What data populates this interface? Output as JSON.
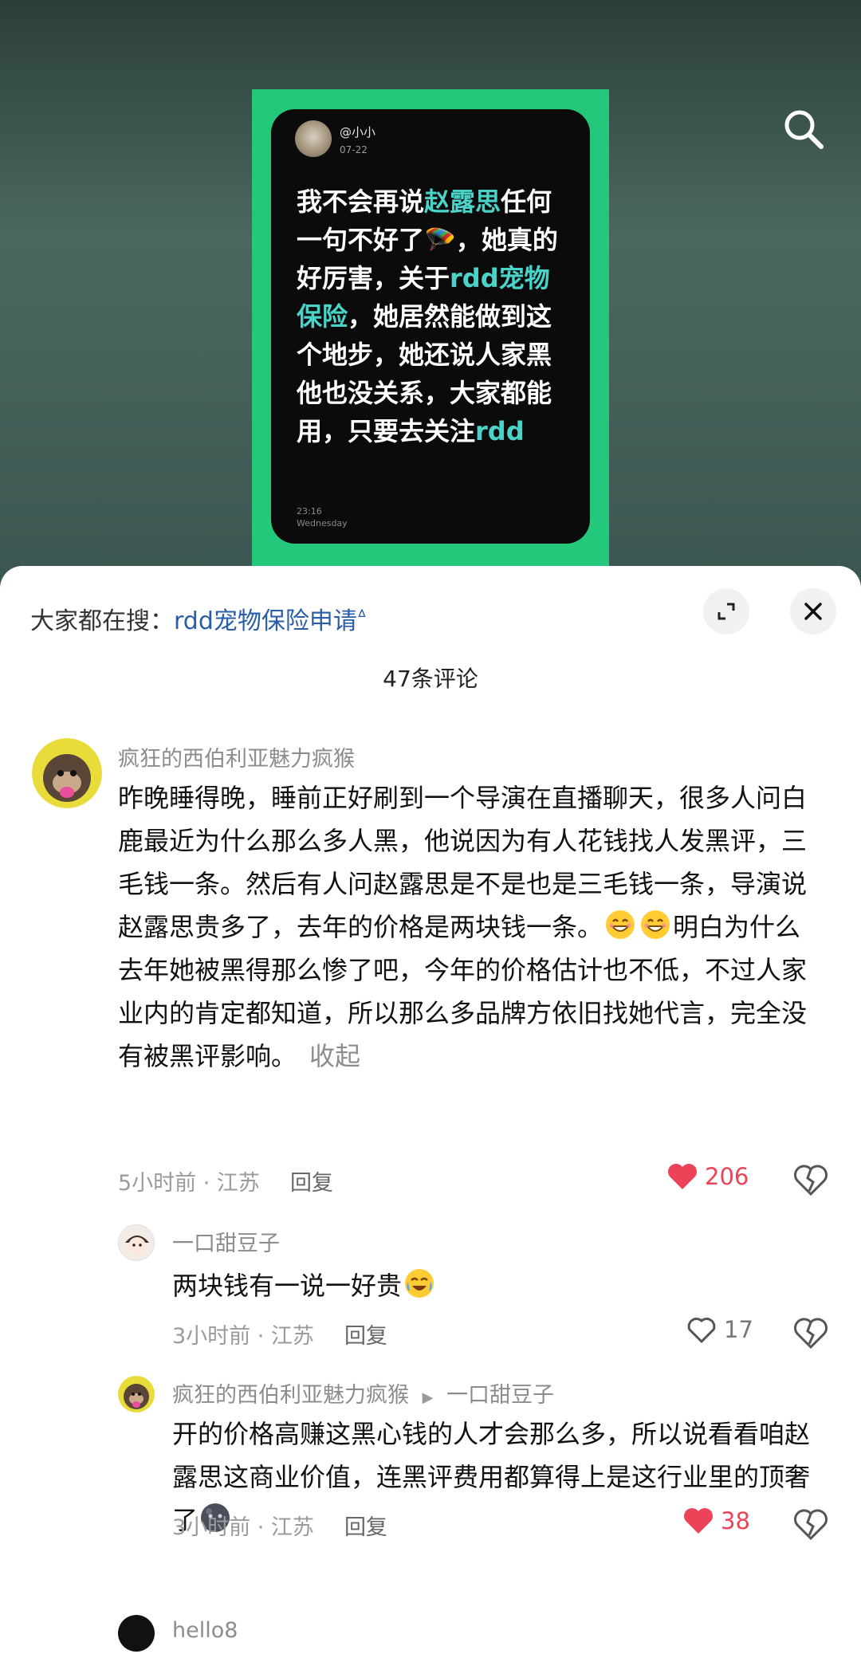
{
  "post": {
    "handle": "@小小",
    "date": "07-22",
    "segments": [
      {
        "text": "我不会再说",
        "hl": false
      },
      {
        "text": "赵露思",
        "hl": true
      },
      {
        "text": "任何一句不好了🪂，她真的好厉害，关于",
        "hl": false
      },
      {
        "text": "rdd宠物保险",
        "hl": true
      },
      {
        "text": "，她居然能做到这个地步，她还说人家黑他也没关系，大家都能用，只要去关注",
        "hl": false
      },
      {
        "text": "rdd",
        "hl": true
      }
    ],
    "time": "23:16",
    "weekday": "Wednesday"
  },
  "sheet": {
    "search_prefix": "大家都在搜：",
    "search_query": "rdd宠物保险申请",
    "comment_count": "47条评论"
  },
  "comments": [
    {
      "user": "疯狂的西伯利亚魅力疯猴",
      "text_a": "昨晚睡得晚，睡前正好刷到一个导演在直播聊天，很多人问白鹿最近为什么那么多人黑，他说因为有人花钱找人发黑评，三毛钱一条。然后有人问赵露思是不是也是三毛钱一条，导演说赵露思贵多了，去年的价格是两块钱一条。",
      "text_b": "明白为什么去年她被黑得那么惨了吧，今年的价格估计也不低，不过人家业内的肯定都知道，所以那么多品牌方依旧找她代言，完全没有被黑评影响。",
      "collapse": "收起",
      "meta": "5小时前 · 江苏",
      "reply": "回复",
      "likes": "206"
    },
    {
      "user": "一口甜豆子",
      "text": "两块钱有一说一好贵",
      "meta": "3小时前 · 江苏",
      "reply": "回复",
      "likes": "17"
    },
    {
      "user": "疯狂的西伯利亚魅力疯猴",
      "reply_to": "一口甜豆子",
      "text": "开的价格高赚这黑心钱的人才会那么多，所以说看看咱赵露思这商业价值，连黑评费用都算得上是这行业里的顶奢了",
      "meta": "3小时前 · 江苏",
      "reply": "回复",
      "likes": "38"
    },
    {
      "user": "hello8"
    }
  ],
  "colors": {
    "accent_green": "#24c87a",
    "highlight": "#4ad3c8",
    "like_red": "#ec4359",
    "link_blue": "#2a5da8"
  }
}
